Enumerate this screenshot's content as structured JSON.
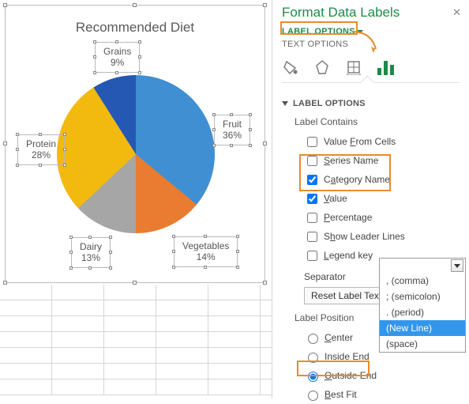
{
  "chart_data": {
    "type": "pie",
    "title": "Recommended Diet",
    "categories": [
      "Fruit",
      "Vegetables",
      "Dairy",
      "Protein",
      "Grains"
    ],
    "values": [
      36,
      14,
      13,
      28,
      9
    ],
    "value_suffix": "%",
    "colors": {
      "Fruit": "#3f8fd2",
      "Vegetables": "#e97c30",
      "Dairy": "#a6a6a6",
      "Protein": "#f2b90f",
      "Grains": "#2458b3"
    },
    "data_labels": {
      "show_category": true,
      "show_value": true,
      "position": "Outside End",
      "separator": "(New Line)"
    }
  },
  "panel": {
    "title": "Format Data Labels",
    "tabs": {
      "label_options": "LABEL OPTIONS",
      "text_options": "TEXT OPTIONS",
      "active": "LABEL OPTIONS"
    },
    "section_head": "LABEL OPTIONS",
    "subhead_contains": "Label Contains",
    "options": {
      "value_from_cells": {
        "label": "Value From Cells",
        "checked": false,
        "ul": "F"
      },
      "series_name": {
        "label": "Series Name",
        "checked": false,
        "ul": "S"
      },
      "category_name": {
        "label": "Category Name",
        "checked": true,
        "ul": "a"
      },
      "value": {
        "label": "Value",
        "checked": true,
        "ul": "V"
      },
      "percentage": {
        "label": "Percentage",
        "checked": false,
        "ul": "P"
      },
      "show_leader": {
        "label": "Show Leader Lines",
        "checked": false,
        "ul": "h"
      },
      "legend_key": {
        "label": "Legend key",
        "checked": false,
        "ul": "L"
      }
    },
    "separator_label": "Separator",
    "reset_label": "Reset Label Text",
    "position_head": "Label Position",
    "positions": {
      "center": {
        "label": "Center",
        "selected": false,
        "ul": "C"
      },
      "inside_end": {
        "label": "Inside End",
        "selected": false,
        "ul": "I"
      },
      "outside_end": {
        "label": "Outside End",
        "selected": true,
        "ul": "O"
      },
      "best_fit": {
        "label": "Best Fit",
        "selected": false,
        "ul": "B"
      }
    },
    "dropdown": {
      "items": [
        ", (comma)",
        "; (semicolon)",
        ". (period)",
        "(New Line)",
        "  (space)"
      ],
      "selected_index": 3
    }
  }
}
